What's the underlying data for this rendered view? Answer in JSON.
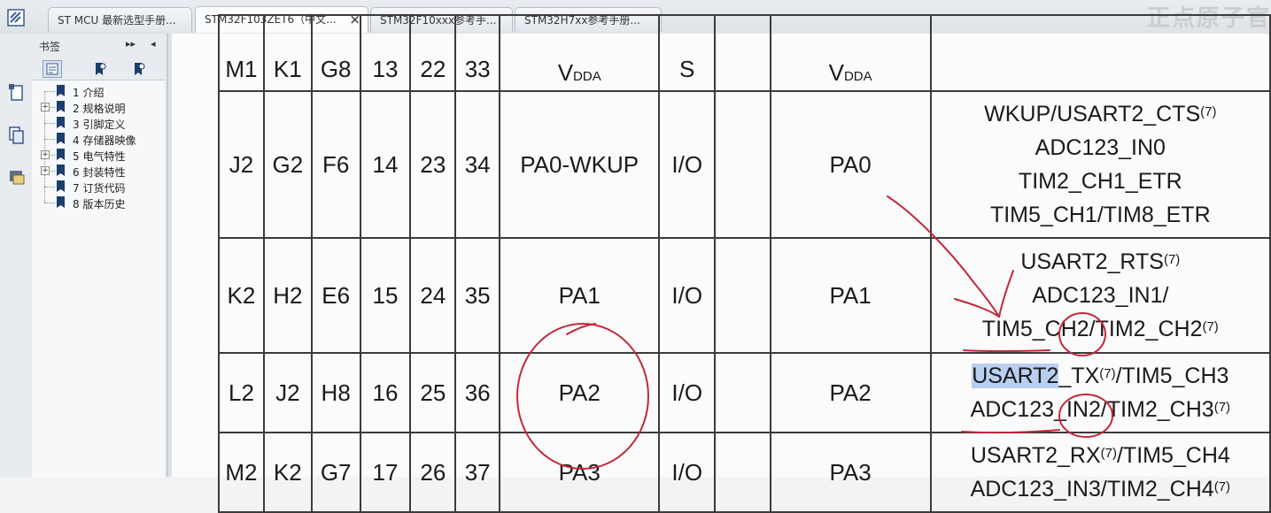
{
  "tabs": [
    {
      "label": "ST MCU 最新选型手册...",
      "active": false
    },
    {
      "label": "STM32F103ZET6（中文...",
      "active": true,
      "close": "×"
    },
    {
      "label": "STM32F10xxx参考手...",
      "active": false
    },
    {
      "label": "STM32H7xx参考手册...",
      "active": false
    }
  ],
  "brand": "正点原子官",
  "bookmarks": {
    "title": "书签",
    "expand_label": "▸▸",
    "collapse_label": "◂",
    "items": [
      {
        "label": "1 介绍",
        "expandable": false
      },
      {
        "label": "2 规格说明",
        "expandable": true
      },
      {
        "label": "3 引脚定义",
        "expandable": false
      },
      {
        "label": "4 存储器映像",
        "expandable": false
      },
      {
        "label": "5 电气特性",
        "expandable": true
      },
      {
        "label": "6 封装特性",
        "expandable": true
      },
      {
        "label": "7 订货代码",
        "expandable": false
      },
      {
        "label": "8 版本历史",
        "expandable": false
      }
    ]
  },
  "table": {
    "header": {
      "c0": "M1",
      "c1": "K1",
      "c2": "G8",
      "c3": "13",
      "c4": "22",
      "c5": "33",
      "name_main": "V",
      "name_sub": "DDA",
      "type": "S",
      "default_main": "V",
      "default_sub": "DDA"
    },
    "rows": [
      {
        "c0": "J2",
        "c1": "G2",
        "c2": "F6",
        "c3": "14",
        "c4": "23",
        "c5": "34",
        "name": "PA0-WKUP",
        "type": "I/O",
        "default": "PA0",
        "alt": [
          "WKUP/USART2_CTS",
          "ADC123_IN0",
          "TIM2_CH1_ETR",
          "TIM5_CH1/TIM8_ETR"
        ],
        "note": "(7)"
      },
      {
        "c0": "K2",
        "c1": "H2",
        "c2": "E6",
        "c3": "15",
        "c4": "24",
        "c5": "35",
        "name": "PA1",
        "type": "I/O",
        "default": "PA1",
        "alt": [
          "USART2_RTS",
          "ADC123_IN1/",
          "TIM5_CH2/TIM2_CH2"
        ],
        "note": "(7)"
      },
      {
        "c0": "L2",
        "c1": "J2",
        "c2": "H8",
        "c3": "16",
        "c4": "25",
        "c5": "36",
        "name": "PA2",
        "type": "I/O",
        "default": "PA2",
        "alt_a": "USART2",
        "alt_b": "_TX",
        "alt_c": "/TIM5_CH3",
        "alt2": "ADC123_IN2/TIM2_CH3",
        "note": "(7)"
      },
      {
        "c0": "M2",
        "c1": "K2",
        "c2": "G7",
        "c3": "17",
        "c4": "26",
        "c5": "37",
        "name": "PA3",
        "type": "I/O",
        "default": "PA3",
        "alt_a": "USART2_RX",
        "alt_c": "/TIM5_CH4",
        "alt2": "ADC123_IN3/TIM2_CH4",
        "note": "(7)"
      }
    ]
  },
  "colors": {
    "annotation": "#c4273a",
    "highlight": "#b9cff0"
  }
}
